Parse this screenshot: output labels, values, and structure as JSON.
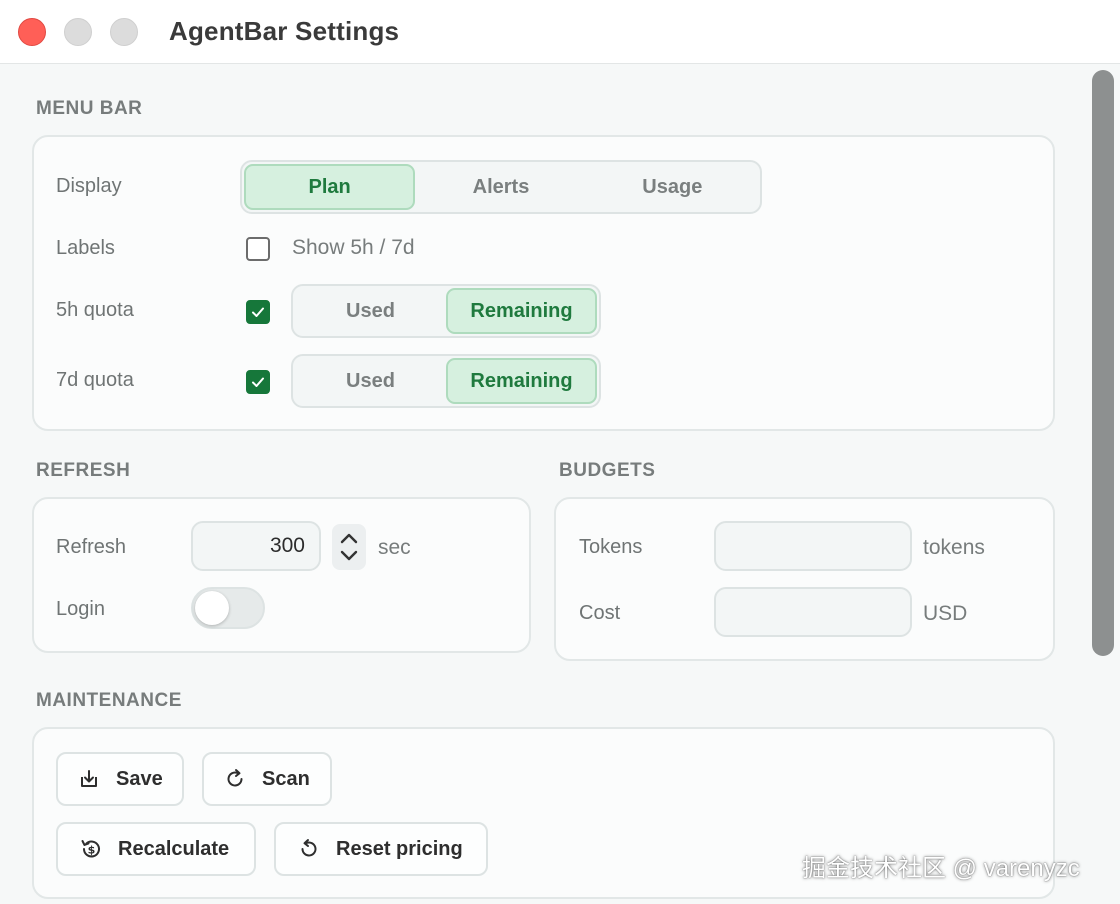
{
  "window": {
    "title": "AgentBar Settings"
  },
  "menu_bar": {
    "title": "MENU BAR",
    "display": {
      "label": "Display",
      "options": [
        "Plan",
        "Alerts",
        "Usage"
      ],
      "selected": "Plan"
    },
    "labels": {
      "label": "Labels",
      "checkbox_text": "Show 5h / 7d",
      "checked": false
    },
    "quota_5h": {
      "label": "5h quota",
      "checked": true,
      "options": [
        "Used",
        "Remaining"
      ],
      "selected": "Remaining"
    },
    "quota_7d": {
      "label": "7d quota",
      "checked": true,
      "options": [
        "Used",
        "Remaining"
      ],
      "selected": "Remaining"
    }
  },
  "refresh": {
    "title": "REFRESH",
    "refresh": {
      "label": "Refresh",
      "value": "300",
      "unit": "sec"
    },
    "login": {
      "label": "Login",
      "enabled": false
    }
  },
  "budgets": {
    "title": "BUDGETS",
    "tokens": {
      "label": "Tokens",
      "value": "",
      "unit": "tokens"
    },
    "cost": {
      "label": "Cost",
      "value": "",
      "unit": "USD"
    }
  },
  "maintenance": {
    "title": "MAINTENANCE",
    "save_label": "Save",
    "scan_label": "Scan",
    "recalculate_label": "Recalculate",
    "reset_pricing_label": "Reset pricing"
  },
  "icons": {
    "save": "download-icon",
    "scan": "refresh-icon",
    "recalculate": "dollar-history-icon",
    "reset_pricing": "reset-icon"
  },
  "colors": {
    "accent_green": "#1f7a3e",
    "checkbox_green": "#16773a",
    "segment_active_bg": "#d6f0df",
    "close_red": "#ff5f57"
  },
  "watermark": "掘金技术社区 @ varenyzc"
}
